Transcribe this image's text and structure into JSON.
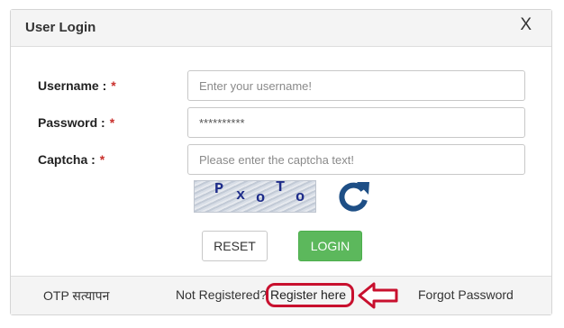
{
  "modal": {
    "title": "User Login",
    "close_label": "X"
  },
  "form": {
    "username": {
      "label": "Username :",
      "required_mark": "*",
      "placeholder": "Enter your username!",
      "value": ""
    },
    "password": {
      "label": "Password :",
      "required_mark": "*",
      "placeholder": "",
      "value": "**********"
    },
    "captcha": {
      "label": "Captcha :",
      "required_mark": "*",
      "placeholder": "Please enter the captcha text!",
      "value": "",
      "image_text": "PxoTo"
    }
  },
  "buttons": {
    "reset_label": "RESET",
    "login_label": "LOGIN"
  },
  "footer": {
    "otp_label": "OTP सत्यापन",
    "not_registered_text": "Not Registered?",
    "register_link": "Register here",
    "forgot_link": "Forgot Password"
  },
  "colors": {
    "accent_green": "#5cb85c",
    "required_red": "#c9302c",
    "annotation_red": "#c8102e",
    "refresh_blue": "#1e4f86"
  },
  "icons": [
    "close-icon",
    "refresh-icon",
    "arrow-left-icon"
  ]
}
